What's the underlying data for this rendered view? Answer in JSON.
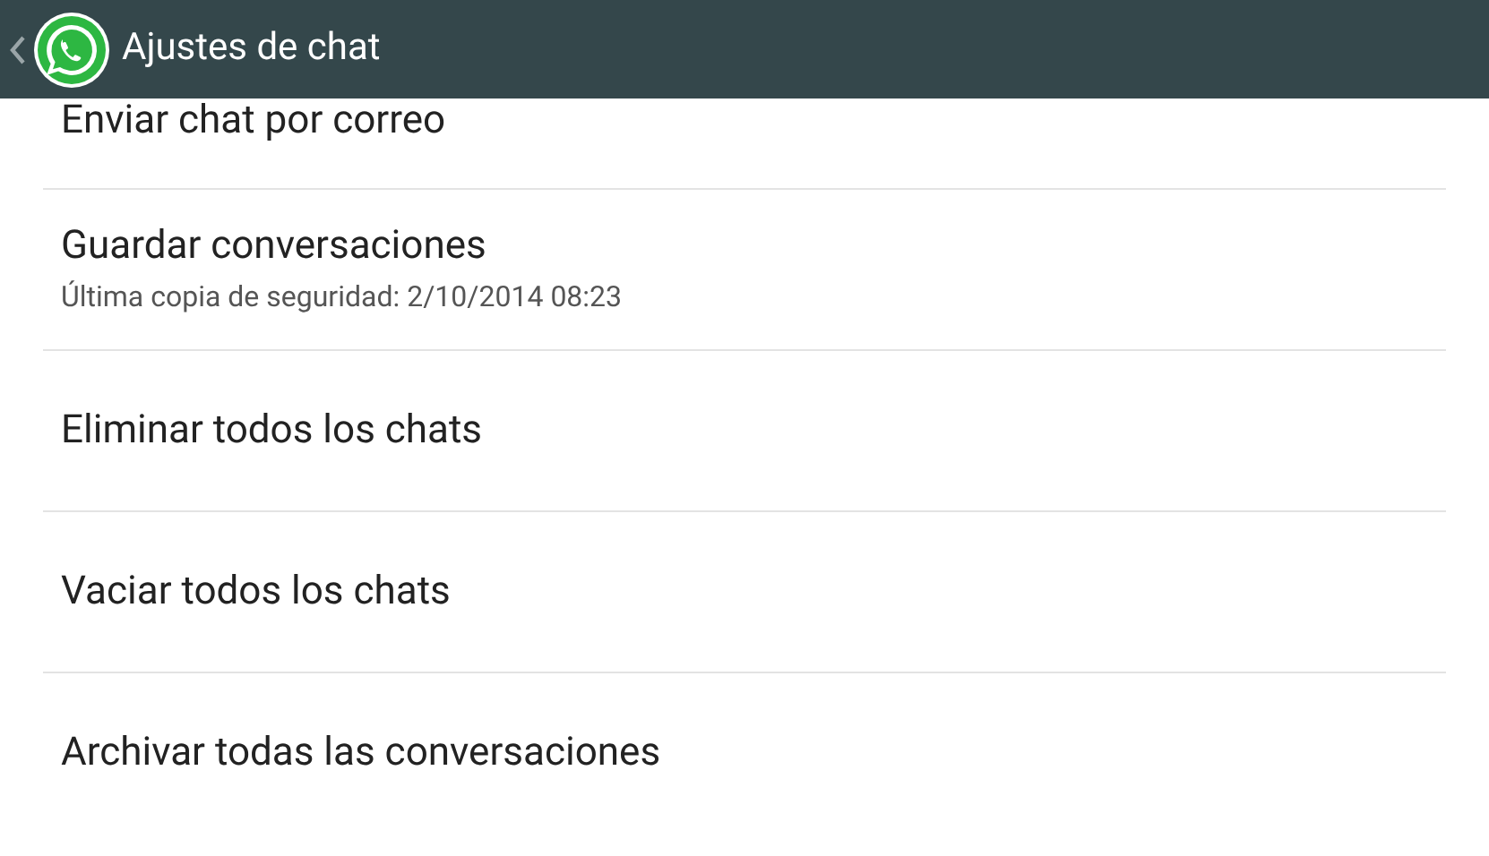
{
  "header": {
    "title": "Ajustes de chat"
  },
  "items": [
    {
      "title": "Enviar chat por correo"
    },
    {
      "title": "Guardar conversaciones",
      "subtitle": "Última copia de seguridad: 2/10/2014 08:23"
    },
    {
      "title": "Eliminar todos los chats"
    },
    {
      "title": "Vaciar todos los chats"
    },
    {
      "title": "Archivar todas las conversaciones"
    }
  ]
}
